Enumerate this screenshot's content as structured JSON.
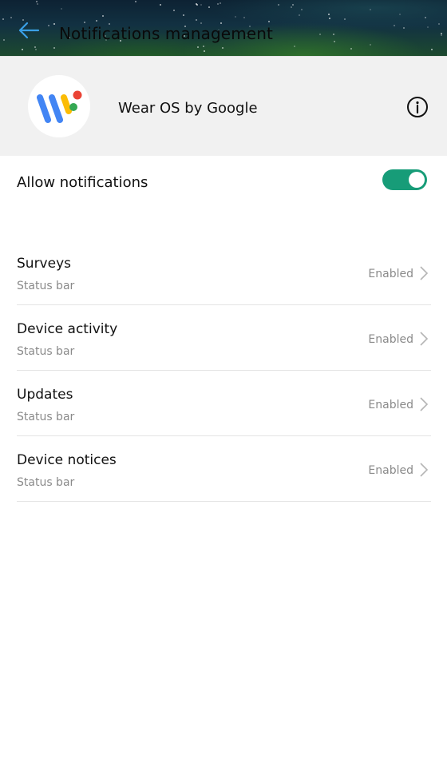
{
  "appbar": {
    "title": "Notifications management",
    "back_icon": "back-arrow-icon",
    "accent": "#3aa0e6"
  },
  "app": {
    "name": "Wear OS by Google",
    "icon": "wear-os-logo",
    "info_icon": "info-icon"
  },
  "allow": {
    "label": "Allow notifications",
    "enabled": true,
    "toggle_color": "#179c78"
  },
  "categories": [
    {
      "title": "Surveys",
      "subtitle": "Status bar",
      "status": "Enabled"
    },
    {
      "title": "Device activity",
      "subtitle": "Status bar",
      "status": "Enabled"
    },
    {
      "title": "Updates",
      "subtitle": "Status bar",
      "status": "Enabled"
    },
    {
      "title": "Device notices",
      "subtitle": "Status bar",
      "status": "Enabled"
    }
  ]
}
